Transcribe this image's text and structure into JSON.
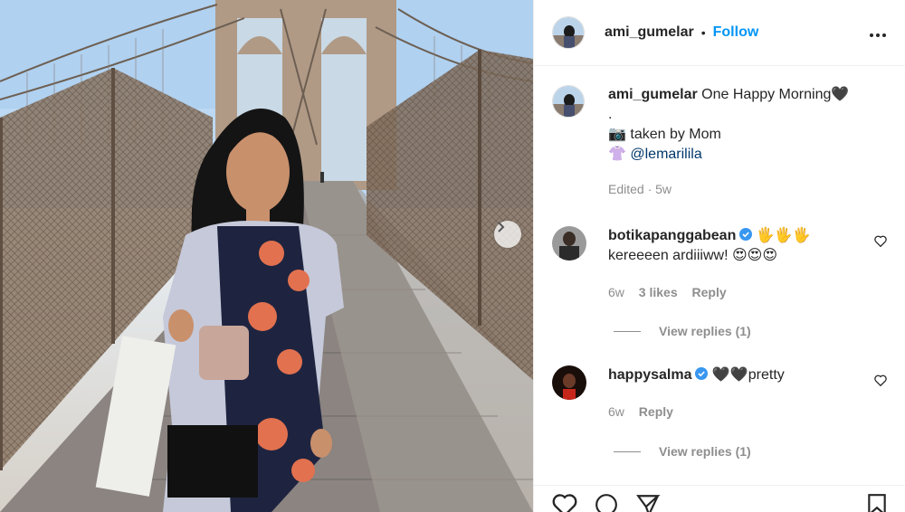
{
  "post": {
    "username": "ami_gumelar",
    "dot": "•",
    "follow_label": "Follow",
    "more_label": "•••"
  },
  "caption": {
    "username": "ami_gumelar",
    "text": "One Happy Morning🖤",
    "line2": ".",
    "line3": "📷 taken by Mom",
    "line4_prefix": "👚 ",
    "mention": "@lemarililа",
    "meta": "Edited · 5w"
  },
  "comments": [
    {
      "username": "botikapanggabean",
      "emoji_suffix": " 🖐🖐🖐",
      "text": "kereeeen ardiiiww! 😍😍😍",
      "time": "6w",
      "likes": "3 likes",
      "reply_label": "Reply",
      "view_replies": "View replies (1)"
    },
    {
      "username": "happysalma",
      "emoji_suffix": " 🖤🖤pretty",
      "text": "",
      "time": "6w",
      "reply_label": "Reply",
      "view_replies": "View replies (1)"
    }
  ],
  "colors": {
    "accent": "#0095f6",
    "verified": "#3897f0",
    "muted": "#8e8e8e"
  }
}
